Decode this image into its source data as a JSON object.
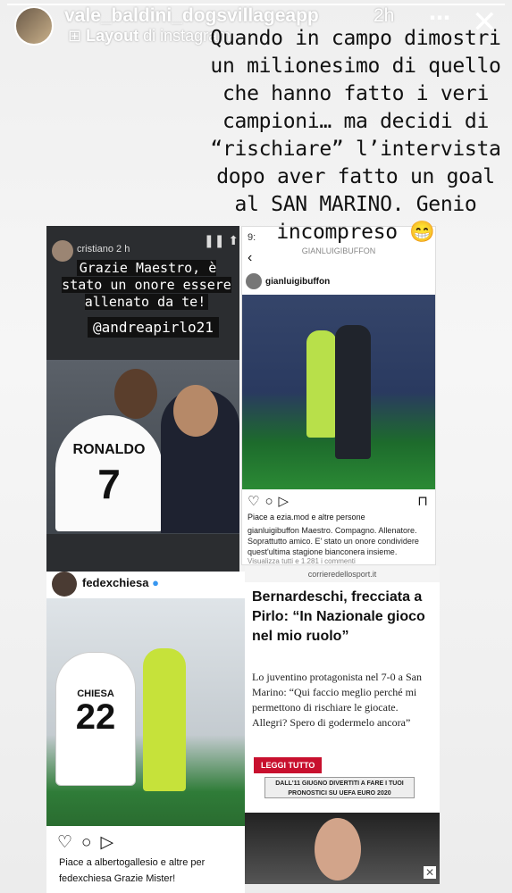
{
  "story": {
    "username": "vale_baldini_dogsvillageapp",
    "time": "2h",
    "layout_label": "Layout",
    "layout_suffix": "di instagram",
    "more_icon": "more-dots-icon",
    "close_icon": "close-icon",
    "progress": 1.0
  },
  "caption": "Quando in campo dimostri un milionesimo di quello che hanno fatto i veri campioni… ma decidi di “rischiare” l’intervista dopo aver fatto un goal al SAN MARINO. Genio incompreso 😁",
  "cristiano_story": {
    "username": "cristiano",
    "time": "2 h",
    "quote": "Grazie Maestro, è stato un onore essere allenato da te!",
    "mention": "@andreapirlo21",
    "jersey_name": "RONALDO",
    "jersey_number": "7"
  },
  "buffon_post": {
    "status_time": "9:",
    "header": "GIANLUIGIBUFFON",
    "username": "gianluigibuffon",
    "likes": "Piace a ezia.mod e altre persone",
    "caption": "gianluigibuffon Maestro. Compagno. Allenatore. Soprattutto amico. E' stato un onore condividere quest'ultima stagione bianconera insieme.",
    "comments": "Visualizza tutti e 1.281 i commenti"
  },
  "chiesa_post": {
    "username": "fedexchiesa",
    "jersey_name": "CHIESA",
    "jersey_number": "22",
    "likes": "Piace a albertogallesio e altre per",
    "caption": "fedexchiesa Grazie Mister!"
  },
  "article": {
    "url": "corrieredellosport.it",
    "title": "Bernardeschi, frecciata a Pirlo: “In Nazionale gioco nel mio ruolo”",
    "body": "Lo juventino protagonista nel 7-0 a San Marino: “Qui faccio meglio perché mi permettono di rischiare le giocate. Allegri? Spero di godermelo ancora”",
    "button": "LEGGI TUTTO",
    "ad_text": "DALL'11 GIUGNO DIVERTITI A FARE I TUOI PRONOSTICI SU UEFA EURO 2020"
  }
}
